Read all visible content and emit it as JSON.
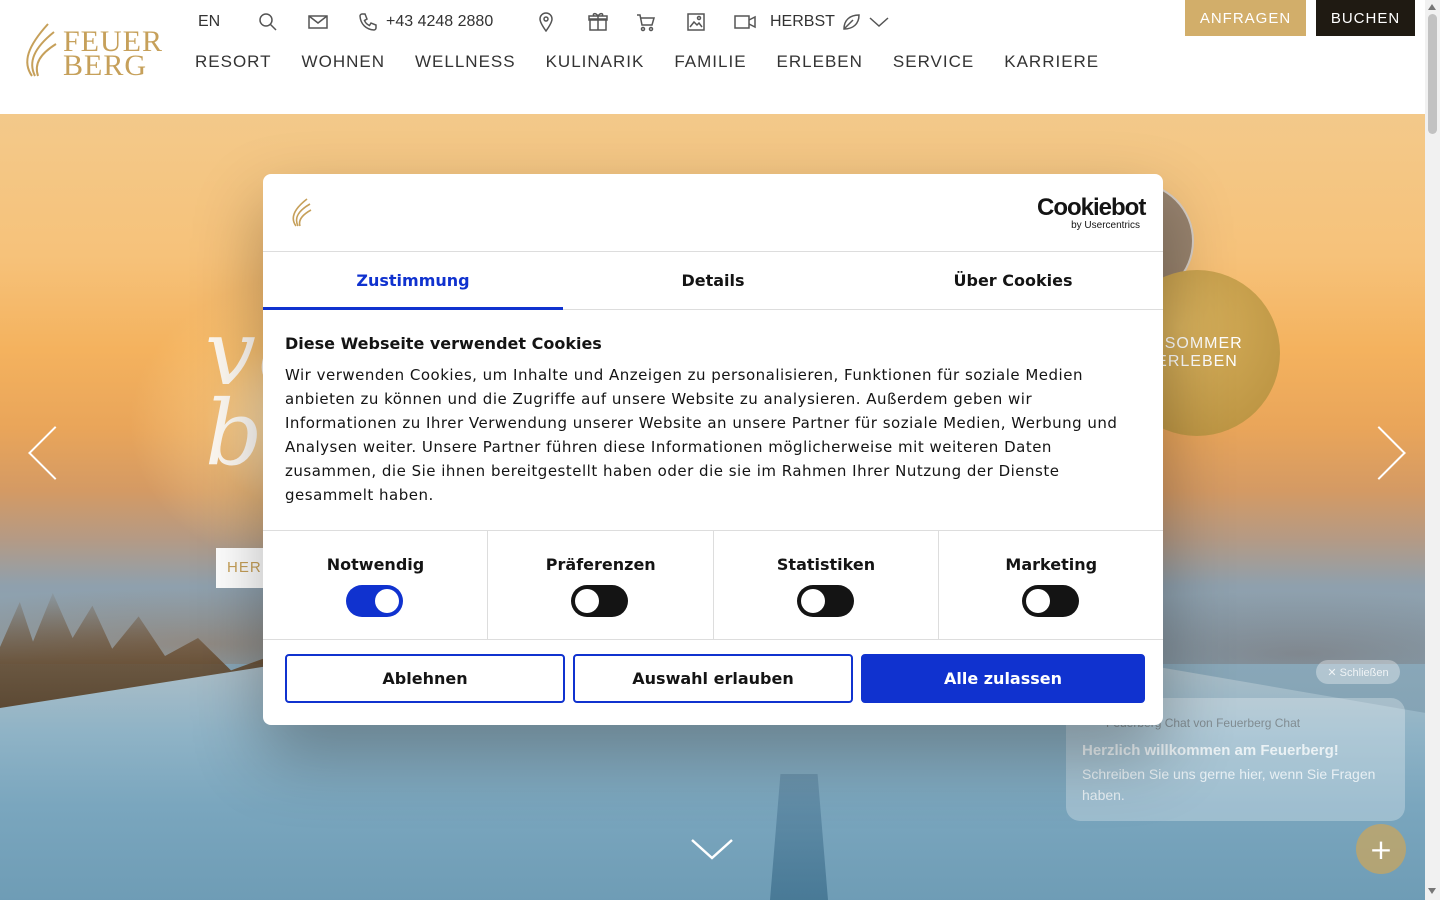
{
  "header": {
    "logo_line1": "FEUER",
    "logo_line2": "BERG",
    "lang": "EN",
    "phone": "+43 4248 2880",
    "season": "HERBST",
    "anfragen_label": "ANFRAGEN",
    "buchen_label": "BUCHEN",
    "nav": [
      "RESORT",
      "WOHNEN",
      "WELLNESS",
      "KULINARIK",
      "FAMILIE",
      "ERLEBEN",
      "SERVICE",
      "KARRIERE"
    ],
    "accent_gold": "#d2ae6a",
    "dark": "#1f1a12"
  },
  "hero": {
    "ghost_text_line1": "ve",
    "ghost_text_line2": "b",
    "ghost_button": "HER",
    "circle_gold_line1": "GSOMMER",
    "circle_gold_line2": "ERLEBEN"
  },
  "chat": {
    "close_label": "✕ Schließen",
    "from": "Feuerberg Chat von Feuerberg Chat",
    "title": "Herzlich willkommen am Feuerberg!",
    "body": "Schreiben Sie uns gerne hier, wenn Sie Fragen haben.",
    "fab_icon": "plus-icon"
  },
  "cookie_dialog": {
    "brand_big": "Cookiebot",
    "brand_small": "by Usercentrics",
    "tabs": [
      {
        "label": "Zustimmung",
        "active": true
      },
      {
        "label": "Details",
        "active": false
      },
      {
        "label": "Über Cookies",
        "active": false
      }
    ],
    "title": "Diese Webseite verwendet Cookies",
    "text": "Wir verwenden Cookies, um Inhalte und Anzeigen zu personalisieren, Funktionen für soziale Medien anbieten zu können und die Zugriffe auf unsere Website zu analysieren. Außerdem geben wir Informationen zu Ihrer Verwendung unserer Website an unsere Partner für soziale Medien, Werbung und Analysen weiter. Unsere Partner führen diese Informationen möglicherweise mit weiteren Daten zusammen, die Sie ihnen bereitgestellt haben oder die sie im Rahmen Ihrer Nutzung der Dienste gesammelt haben.",
    "categories": [
      {
        "label": "Notwendig",
        "enabled": true
      },
      {
        "label": "Präferenzen",
        "enabled": false
      },
      {
        "label": "Statistiken",
        "enabled": false
      },
      {
        "label": "Marketing",
        "enabled": false
      }
    ],
    "buttons": {
      "decline": "Ablehnen",
      "allow_selection": "Auswahl erlauben",
      "allow_all": "Alle zulassen"
    },
    "accent_blue": "#1032cf"
  }
}
